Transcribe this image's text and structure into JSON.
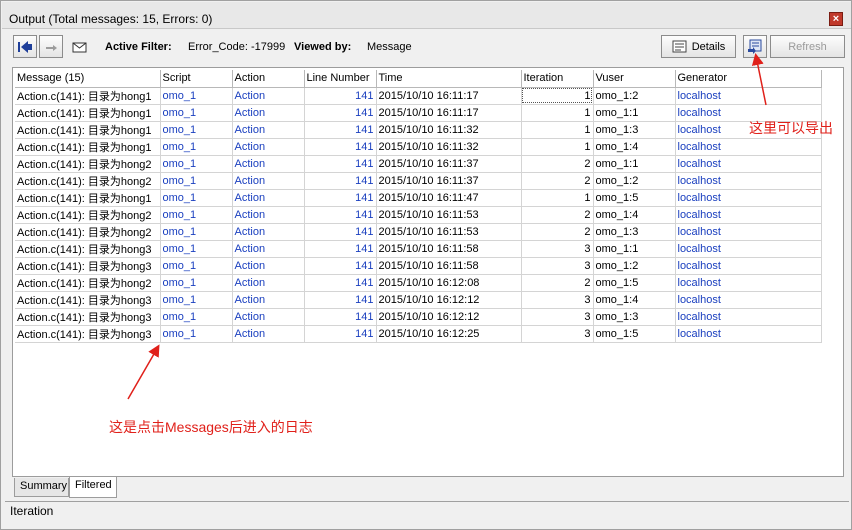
{
  "window": {
    "title": "Output (Total messages: 15,  Errors: 0)"
  },
  "toolbar": {
    "active_filter_label": "Active Filter:",
    "active_filter_value": "Error_Code: -17999",
    "viewed_by_label": "Viewed by:",
    "viewed_by_value": "Message",
    "details_label": "Details",
    "refresh_label": "Refresh"
  },
  "table": {
    "columns": [
      "Message (15)",
      "Script",
      "Action",
      "Line Number",
      "Time",
      "Iteration",
      "Vuser",
      "Generator"
    ],
    "rows": [
      [
        "Action.c(141): 目录为hong1",
        "omo_1",
        "Action",
        "141",
        "2015/10/10 16:11:17",
        "1",
        "omo_1:2",
        "localhost"
      ],
      [
        "Action.c(141): 目录为hong1",
        "omo_1",
        "Action",
        "141",
        "2015/10/10 16:11:17",
        "1",
        "omo_1:1",
        "localhost"
      ],
      [
        "Action.c(141): 目录为hong1",
        "omo_1",
        "Action",
        "141",
        "2015/10/10 16:11:32",
        "1",
        "omo_1:3",
        "localhost"
      ],
      [
        "Action.c(141): 目录为hong1",
        "omo_1",
        "Action",
        "141",
        "2015/10/10 16:11:32",
        "1",
        "omo_1:4",
        "localhost"
      ],
      [
        "Action.c(141): 目录为hong2",
        "omo_1",
        "Action",
        "141",
        "2015/10/10 16:11:37",
        "2",
        "omo_1:1",
        "localhost"
      ],
      [
        "Action.c(141): 目录为hong2",
        "omo_1",
        "Action",
        "141",
        "2015/10/10 16:11:37",
        "2",
        "omo_1:2",
        "localhost"
      ],
      [
        "Action.c(141): 目录为hong1",
        "omo_1",
        "Action",
        "141",
        "2015/10/10 16:11:47",
        "1",
        "omo_1:5",
        "localhost"
      ],
      [
        "Action.c(141): 目录为hong2",
        "omo_1",
        "Action",
        "141",
        "2015/10/10 16:11:53",
        "2",
        "omo_1:4",
        "localhost"
      ],
      [
        "Action.c(141): 目录为hong2",
        "omo_1",
        "Action",
        "141",
        "2015/10/10 16:11:53",
        "2",
        "omo_1:3",
        "localhost"
      ],
      [
        "Action.c(141): 目录为hong3",
        "omo_1",
        "Action",
        "141",
        "2015/10/10 16:11:58",
        "3",
        "omo_1:1",
        "localhost"
      ],
      [
        "Action.c(141): 目录为hong3",
        "omo_1",
        "Action",
        "141",
        "2015/10/10 16:11:58",
        "3",
        "omo_1:2",
        "localhost"
      ],
      [
        "Action.c(141): 目录为hong2",
        "omo_1",
        "Action",
        "141",
        "2015/10/10 16:12:08",
        "2",
        "omo_1:5",
        "localhost"
      ],
      [
        "Action.c(141): 目录为hong3",
        "omo_1",
        "Action",
        "141",
        "2015/10/10 16:12:12",
        "3",
        "omo_1:4",
        "localhost"
      ],
      [
        "Action.c(141): 目录为hong3",
        "omo_1",
        "Action",
        "141",
        "2015/10/10 16:12:12",
        "3",
        "omo_1:3",
        "localhost"
      ],
      [
        "Action.c(141): 目录为hong3",
        "omo_1",
        "Action",
        "141",
        "2015/10/10 16:12:25",
        "3",
        "omo_1:5",
        "localhost"
      ]
    ]
  },
  "annotations": {
    "export_note": "这里可以导出",
    "log_note": "这是点击Messages后进入的日志",
    "color": "#e0201a"
  },
  "tabs": [
    "Summary",
    "Filtered"
  ],
  "status": {
    "text": "Iteration"
  },
  "colors": {
    "link": "#1a3fbf",
    "annotation": "#e0201a"
  }
}
